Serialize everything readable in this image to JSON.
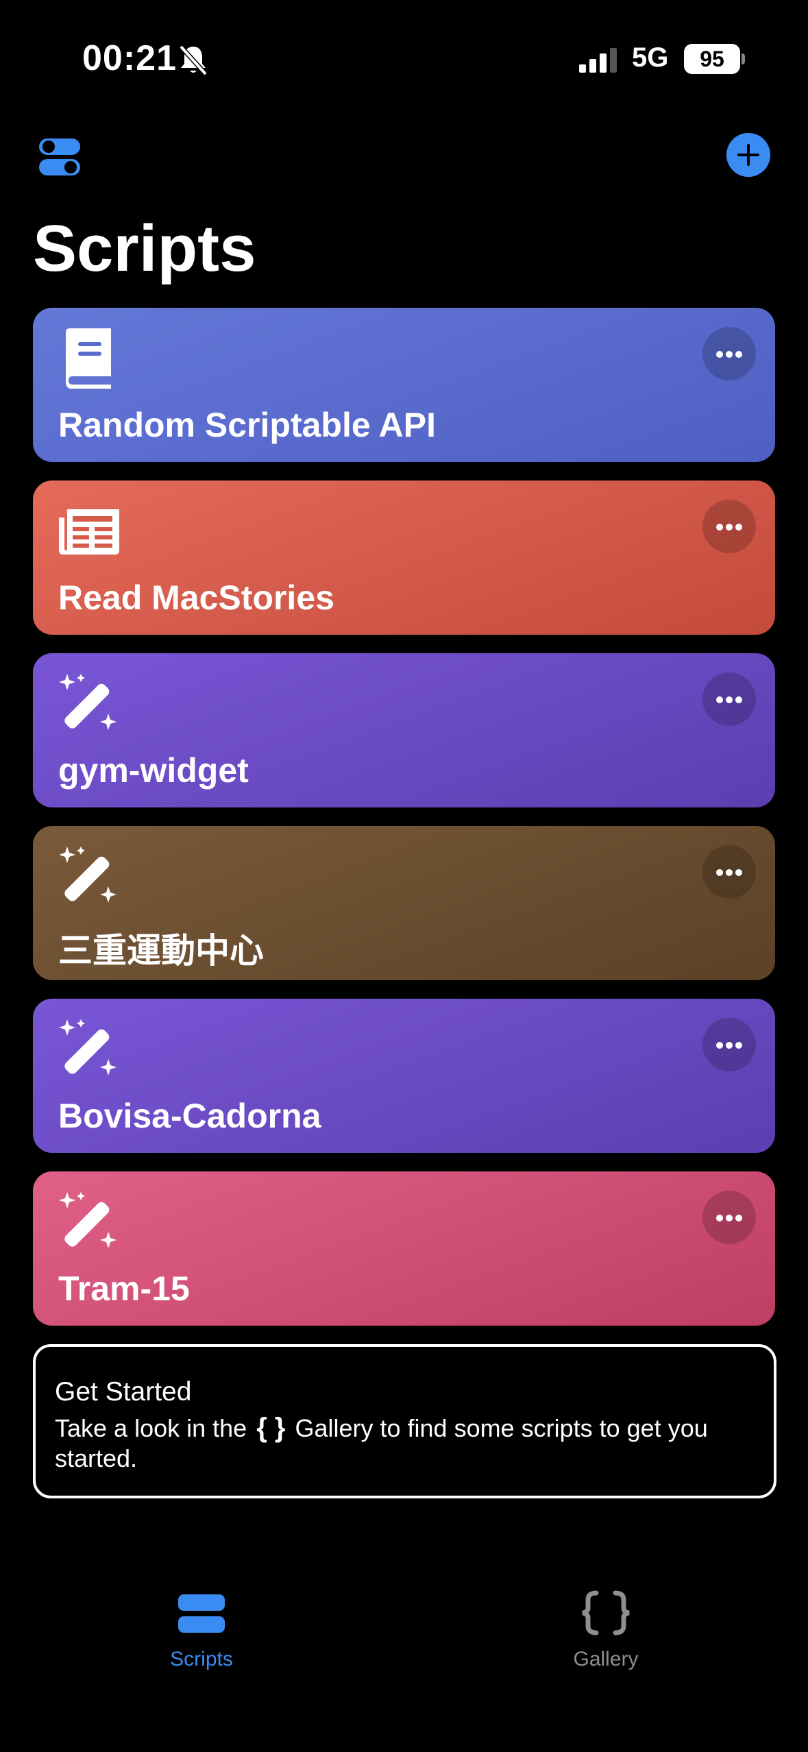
{
  "status_bar": {
    "time": "00:21",
    "network": "5G",
    "battery": "95"
  },
  "header": {
    "title": "Scripts"
  },
  "scripts": [
    {
      "name": "Random Scriptable API",
      "icon": "book-icon",
      "color_start": "#6478d8",
      "color_end": "#4f5fc2"
    },
    {
      "name": "Read MacStories",
      "icon": "newspaper-icon",
      "color_start": "#e46a5a",
      "color_end": "#c44a3c"
    },
    {
      "name": "gym-widget",
      "icon": "magic-wand-icon",
      "color_start": "#7a56d6",
      "color_end": "#5b3fb0"
    },
    {
      "name": "三重運動中心",
      "icon": "magic-wand-icon",
      "color_start": "#7a5a3a",
      "color_end": "#5c4126"
    },
    {
      "name": "Bovisa-Cadorna",
      "icon": "magic-wand-icon",
      "color_start": "#7a56d6",
      "color_end": "#5b3fb0"
    },
    {
      "name": "Tram-15",
      "icon": "magic-wand-icon",
      "color_start": "#e06088",
      "color_end": "#bf3e63"
    }
  ],
  "get_started": {
    "title": "Get Started",
    "text_before": "Take a look in the",
    "braces": "{ }",
    "text_after": "Gallery to find some scripts to get you started."
  },
  "tabs": [
    {
      "label": "Scripts",
      "icon": "stack-icon",
      "active": true
    },
    {
      "label": "Gallery",
      "icon": "braces-icon",
      "active": false
    }
  ],
  "colors": {
    "accent": "#3b8cf2",
    "inactive": "#8e8e93"
  }
}
